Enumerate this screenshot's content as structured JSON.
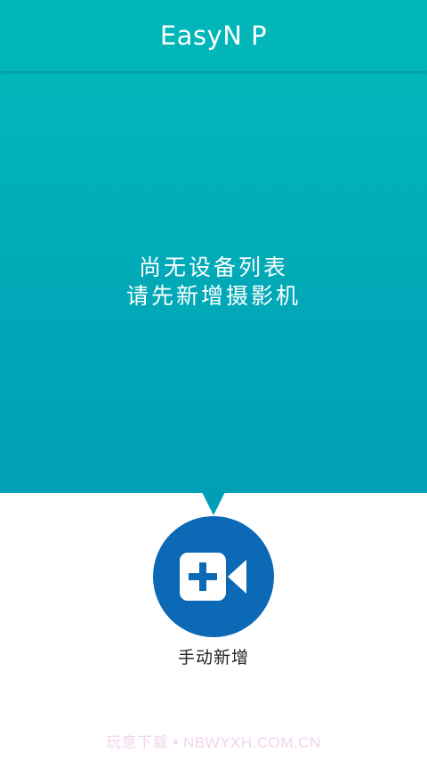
{
  "app_bar": {
    "title": "EasyN P"
  },
  "empty_state": {
    "line1": "尚无设备列表",
    "line2": "请先新增摄影机"
  },
  "add_action": {
    "icon": "video-camera-add-icon",
    "label": "手动新增"
  },
  "watermark": {
    "text": "玩意下载 • NBWYXH.COM.CN"
  },
  "colors": {
    "header": "#00b6b9",
    "hero_bottom": "#009fb6",
    "button": "#0b69b5"
  }
}
